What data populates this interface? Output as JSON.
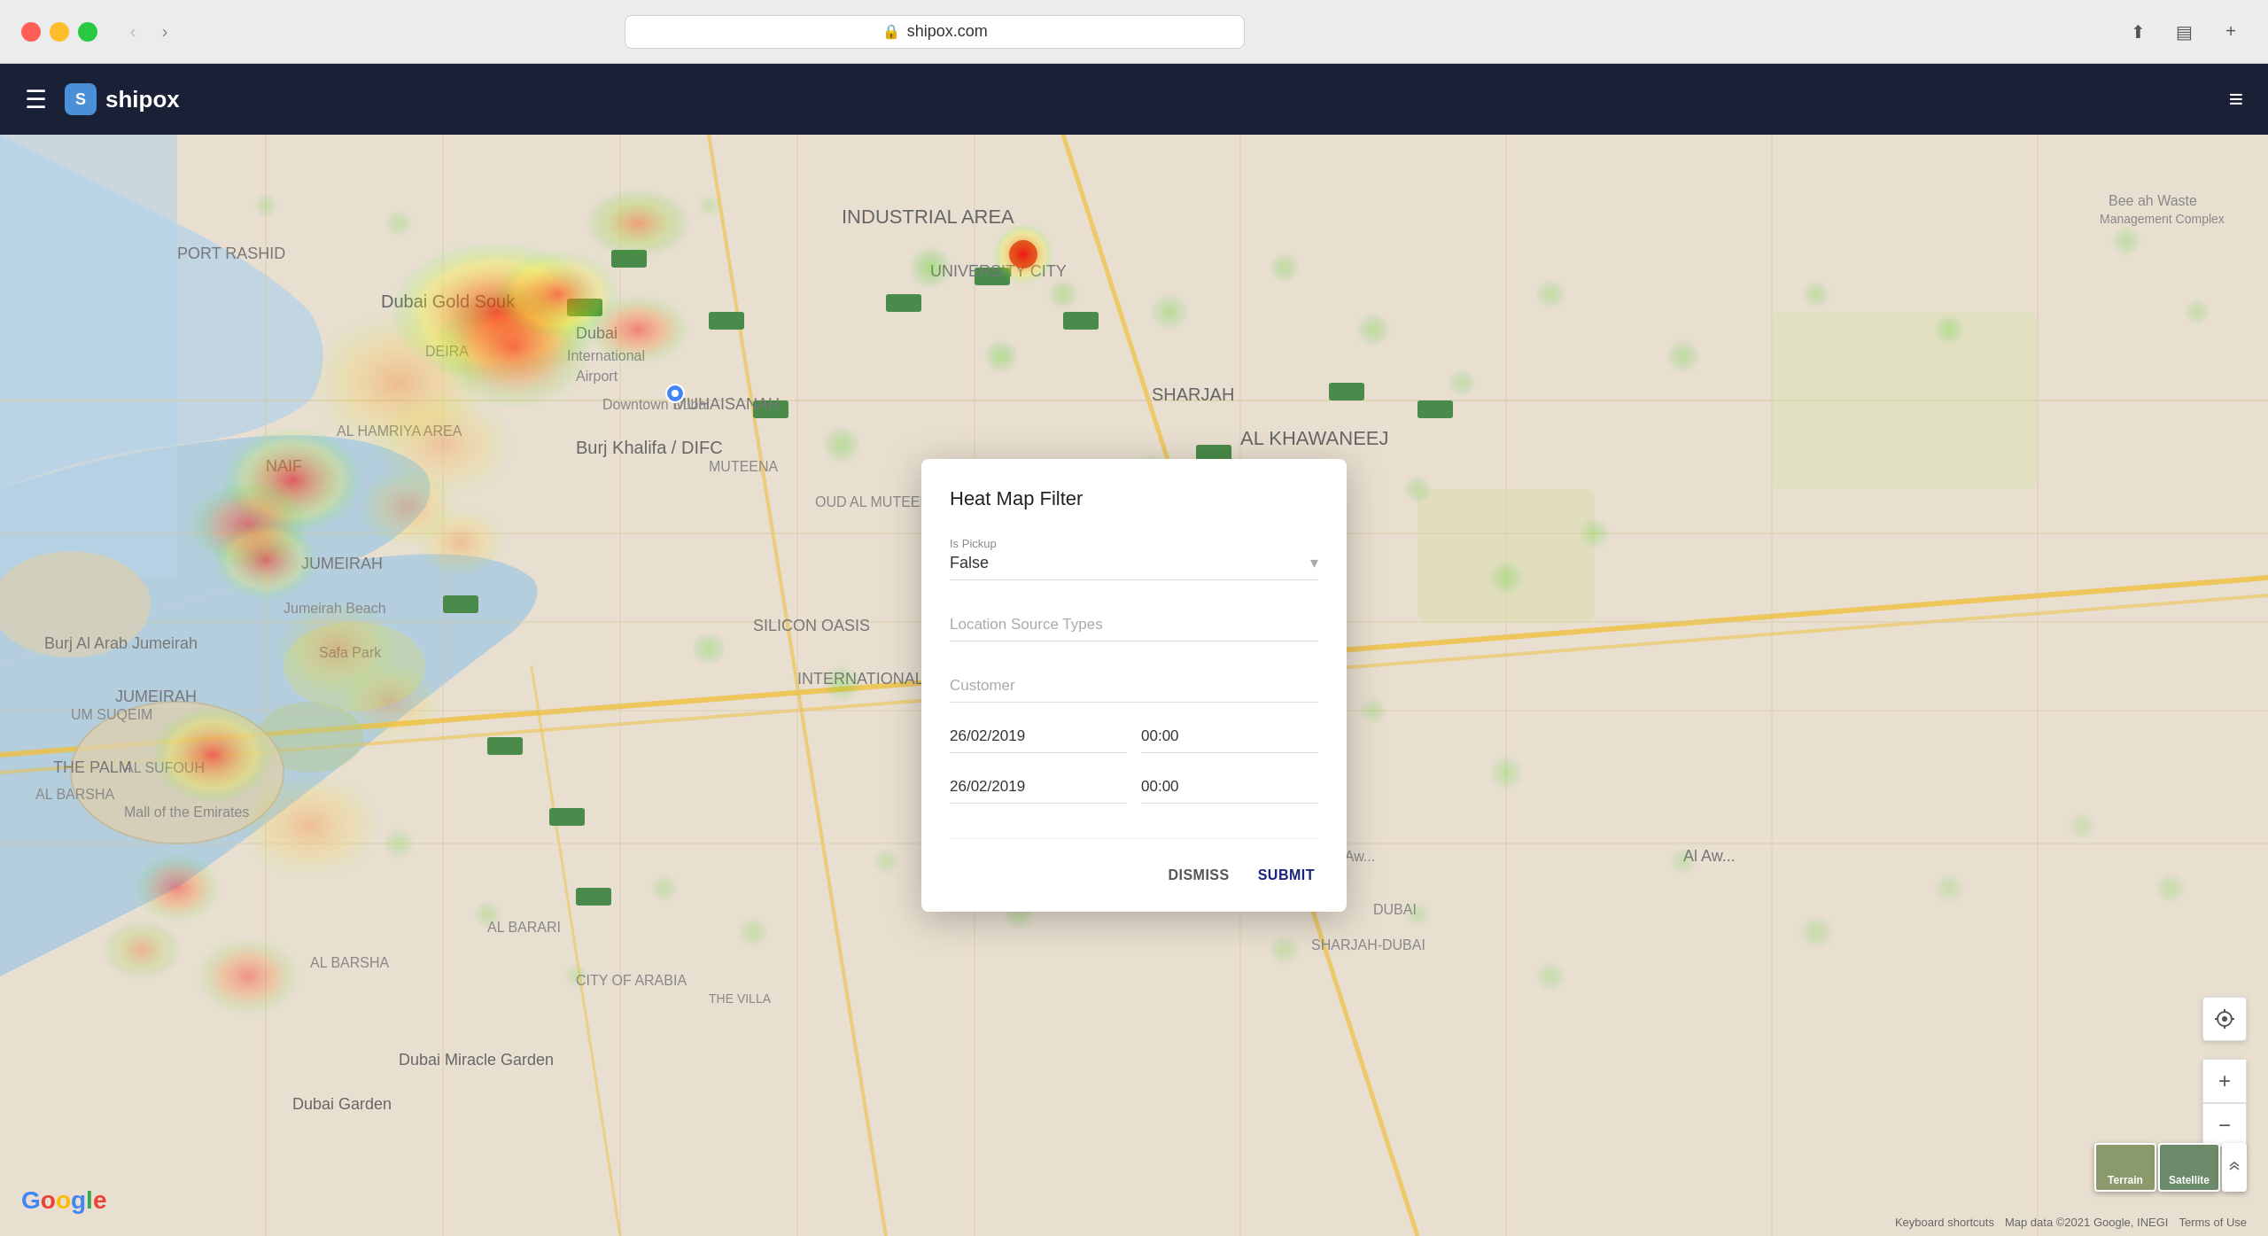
{
  "browser": {
    "url": "shipox.com",
    "back_arrow": "‹",
    "forward_arrow": "›"
  },
  "header": {
    "brand": "shipox",
    "hamburger_label": "☰",
    "menu_label": "≡"
  },
  "modal": {
    "title": "Heat Map Filter",
    "is_pickup_label": "Is Pickup",
    "is_pickup_value": "False",
    "location_source_label": "Location Source Types",
    "customer_label": "Customer",
    "date_from": "26/02/2019",
    "time_from": "00:00",
    "date_to": "26/02/2019",
    "time_to": "00:00",
    "dismiss_label": "DISMISS",
    "submit_label": "SUBMIT"
  },
  "map": {
    "google_letters": [
      "G",
      "o",
      "o",
      "g",
      "l",
      "e"
    ],
    "attribution": "Map data ©2021 Google, INEGI",
    "terms": "Terms of Use",
    "keyboard_shortcuts": "Keyboard shortcuts"
  },
  "map_controls": {
    "zoom_in": "+",
    "zoom_out": "−",
    "locate": "⊕",
    "expand": "⤢"
  }
}
